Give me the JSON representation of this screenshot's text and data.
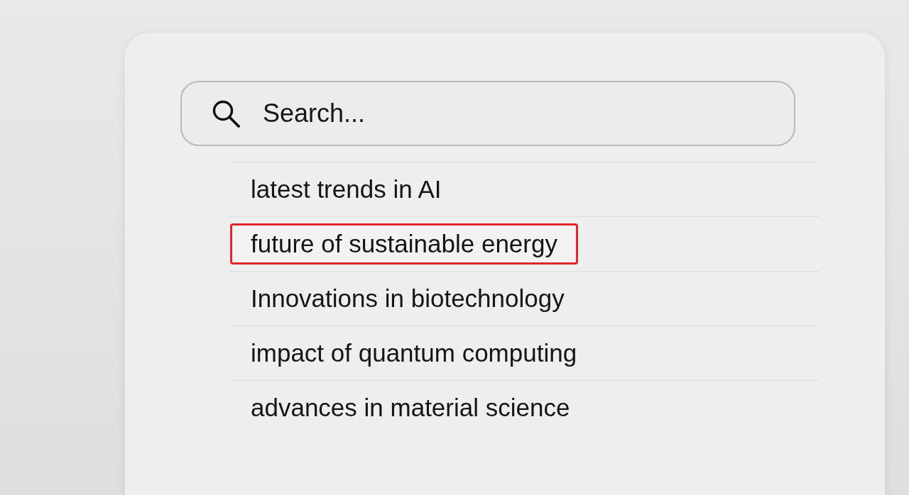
{
  "search": {
    "placeholder": "Search..."
  },
  "suggestions": [
    {
      "text": "latest trends in AI",
      "selected": false
    },
    {
      "text": "future of sustainable energy",
      "selected": true
    },
    {
      "text": "Innovations in biotechnology",
      "selected": false
    },
    {
      "text": "impact of quantum computing",
      "selected": false
    },
    {
      "text": "advances in material science",
      "selected": false
    }
  ]
}
